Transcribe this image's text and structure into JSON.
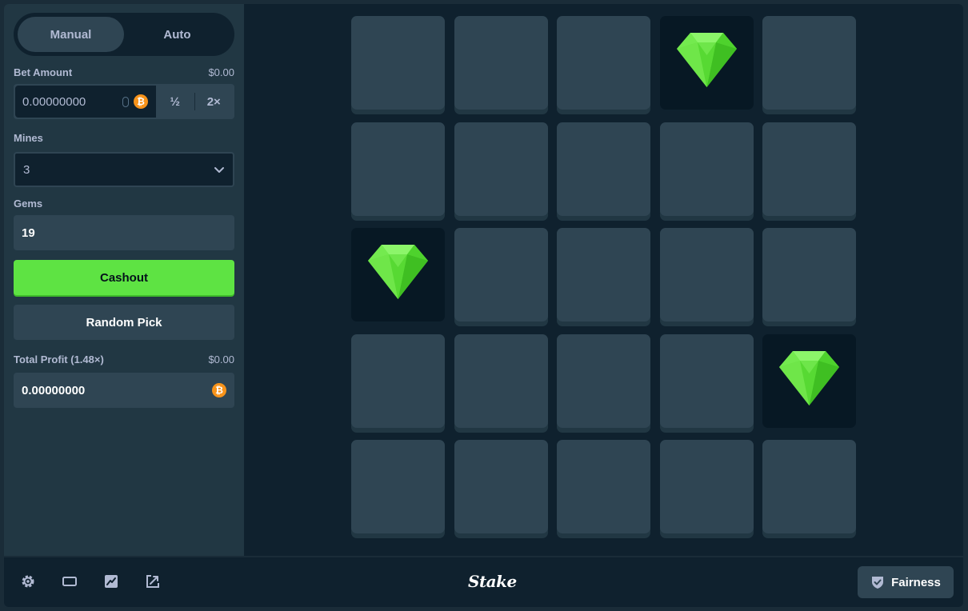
{
  "mode_tabs": [
    {
      "label": "Manual",
      "active": true
    },
    {
      "label": "Auto",
      "active": false
    }
  ],
  "bet": {
    "label": "Bet Amount",
    "usd_value": "$0.00",
    "amount": "0.00000000",
    "currency_icon": "bitcoin-icon",
    "half_label": "½",
    "double_label": "2×"
  },
  "mines": {
    "label": "Mines",
    "selected": "3"
  },
  "gems": {
    "label": "Gems",
    "value": "19"
  },
  "buttons": {
    "cashout_label": "Cashout",
    "random_pick_label": "Random Pick"
  },
  "profit": {
    "label": "Total Profit (1.48×)",
    "usd_value": "$0.00",
    "amount": "0.00000000",
    "currency_icon": "bitcoin-icon"
  },
  "board": {
    "rows": 5,
    "cols": 5,
    "tiles": [
      "hidden",
      "hidden",
      "hidden",
      "gem",
      "hidden",
      "hidden",
      "hidden",
      "hidden",
      "hidden",
      "hidden",
      "gem",
      "hidden",
      "hidden",
      "hidden",
      "hidden",
      "hidden",
      "hidden",
      "hidden",
      "hidden",
      "gem",
      "hidden",
      "hidden",
      "hidden",
      "hidden",
      "hidden"
    ]
  },
  "footer": {
    "icons": [
      "gear-icon",
      "theatre-mode-icon",
      "live-stats-icon",
      "popout-icon"
    ],
    "logo": "Stake",
    "fairness_label": "Fairness"
  },
  "colors": {
    "background": "#1a2c38",
    "panel": "#213743",
    "game_area": "#0f212e",
    "tile": "#2f4553",
    "accent_green": "#5ee343",
    "bitcoin": "#f7931a"
  }
}
